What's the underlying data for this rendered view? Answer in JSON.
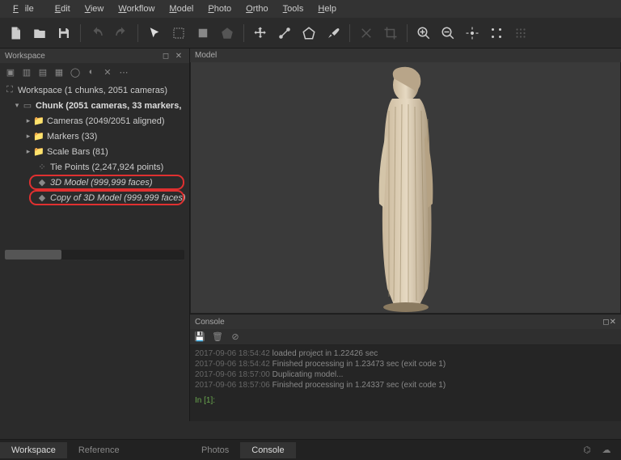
{
  "menu": {
    "file": "File",
    "edit": "Edit",
    "view": "View",
    "workflow": "Workflow",
    "model": "Model",
    "photo": "Photo",
    "ortho": "Ortho",
    "tools": "Tools",
    "help": "Help"
  },
  "panels": {
    "workspace": "Workspace",
    "model": "Model",
    "console": "Console"
  },
  "tree": {
    "root": "Workspace (1 chunks, 2051 cameras)",
    "chunk": "Chunk (2051 cameras, 33 markers,",
    "cameras": "Cameras (2049/2051 aligned)",
    "markers": "Markers (33)",
    "scalebars": "Scale Bars (81)",
    "tiepoints": "Tie Points (2,247,924 points)",
    "model3d": "3D Model (999,999 faces)",
    "copy3d": "Copy of 3D Model (999,999 faces)"
  },
  "console_lines": {
    "l1a": "2017-09-06 18:54:42",
    "l1b": " loaded project in 1.22426 sec",
    "l2a": "2017-09-06 18:54:42",
    "l2b": " Finished processing in 1.23473 sec (exit code 1)",
    "l3a": "2017-09-06 18:57:00",
    "l3b": " Duplicating model...",
    "l4a": "2017-09-06 18:57:06",
    "l4b": " Finished processing in 1.24337 sec (exit code 1)",
    "prompt": "In [1]:"
  },
  "tabs": {
    "workspace": "Workspace",
    "reference": "Reference",
    "photos": "Photos",
    "console": "Console"
  }
}
